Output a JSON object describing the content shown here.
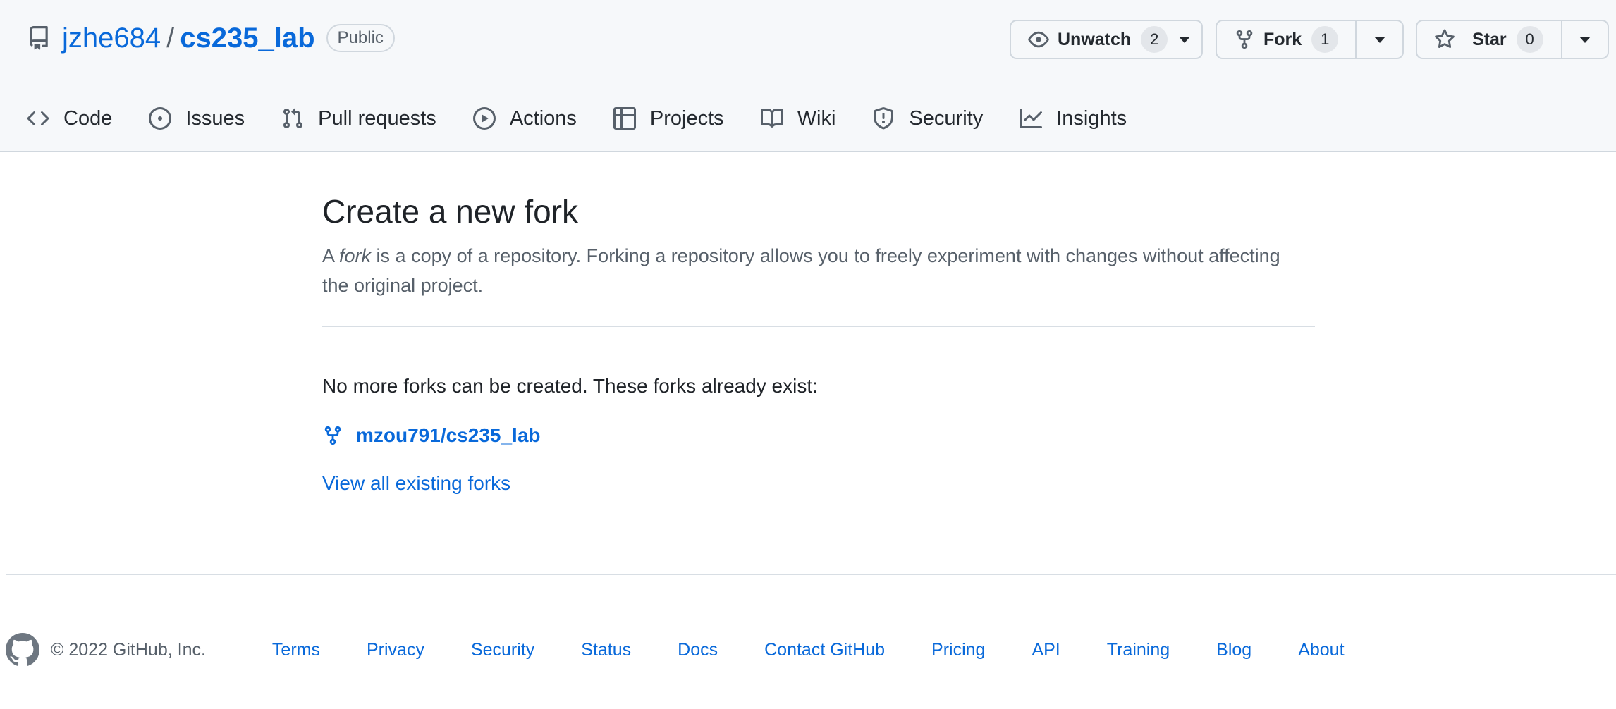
{
  "repo": {
    "owner": "jzhe684",
    "separator": "/",
    "name": "cs235_lab",
    "visibility": "Public"
  },
  "actions": {
    "watch": {
      "label": "Unwatch",
      "count": "2",
      "icon": "eye-icon"
    },
    "fork": {
      "label": "Fork",
      "count": "1",
      "icon": "repo-forked-icon"
    },
    "star": {
      "label": "Star",
      "count": "0",
      "icon": "star-icon"
    }
  },
  "tabs": [
    {
      "label": "Code",
      "icon": "code-icon"
    },
    {
      "label": "Issues",
      "icon": "issue-opened-icon"
    },
    {
      "label": "Pull requests",
      "icon": "git-pull-request-icon"
    },
    {
      "label": "Actions",
      "icon": "play-icon"
    },
    {
      "label": "Projects",
      "icon": "table-icon"
    },
    {
      "label": "Wiki",
      "icon": "book-icon"
    },
    {
      "label": "Security",
      "icon": "shield-icon"
    },
    {
      "label": "Insights",
      "icon": "graph-icon"
    }
  ],
  "main": {
    "title": "Create a new fork",
    "desc_prefix": "A ",
    "desc_em": "fork",
    "desc_rest": " is a copy of a repository. Forking a repository allows you to freely experiment with changes without affecting the original project.",
    "no_more_text": "No more forks can be created. These forks already exist:",
    "existing_fork": "mzou791/cs235_lab",
    "view_all": "View all existing forks"
  },
  "footer": {
    "copyright": "© 2022 GitHub, Inc.",
    "links": [
      "Terms",
      "Privacy",
      "Security",
      "Status",
      "Docs",
      "Contact GitHub",
      "Pricing",
      "API",
      "Training",
      "Blog",
      "About"
    ]
  },
  "colors": {
    "link": "#0969da",
    "muted": "#57606a",
    "header_bg": "#f6f8fa",
    "border": "#d0d7de"
  }
}
